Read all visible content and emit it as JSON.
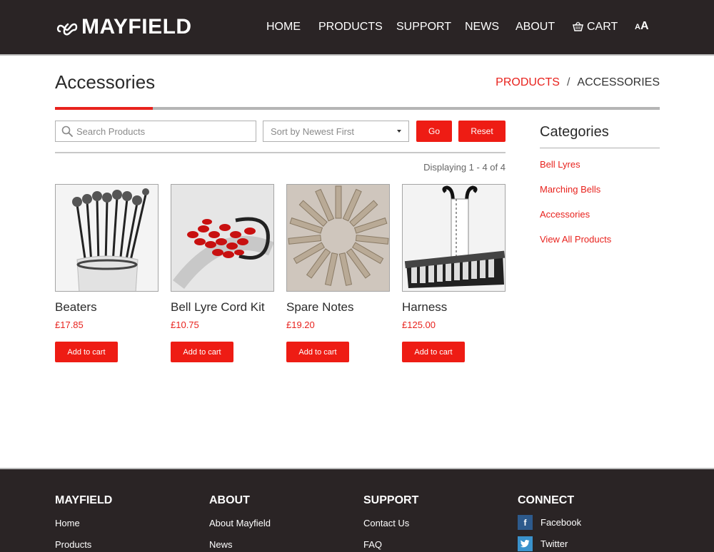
{
  "brand": {
    "name": "MAYFIELD"
  },
  "nav": {
    "items": [
      {
        "label": "HOME"
      },
      {
        "label": "PRODUCTS"
      },
      {
        "label": "SUPPORT"
      },
      {
        "label": "NEWS"
      },
      {
        "label": "ABOUT"
      },
      {
        "label": "CART"
      }
    ],
    "font_small": "A",
    "font_large": "A"
  },
  "page": {
    "title": "Accessories",
    "breadcrumb": {
      "parent": "PRODUCTS",
      "separator": "/",
      "current": "ACCESSORIES"
    }
  },
  "toolbar": {
    "search_placeholder": "Search Products",
    "sort_value": "Sort by Newest First",
    "go_label": "Go",
    "reset_label": "Reset",
    "displaying": "Displaying 1 - 4 of 4"
  },
  "products": [
    {
      "name": "Beaters",
      "price": "£17.85",
      "button": "Add to cart"
    },
    {
      "name": "Bell Lyre Cord Kit",
      "price": "£10.75",
      "button": "Add to cart"
    },
    {
      "name": "Spare Notes",
      "price": "£19.20",
      "button": "Add to cart"
    },
    {
      "name": "Harness",
      "price": "£125.00",
      "button": "Add to cart"
    }
  ],
  "sidebar": {
    "title": "Categories",
    "links": [
      {
        "label": "Bell Lyres"
      },
      {
        "label": "Marching Bells"
      },
      {
        "label": "Accessories"
      },
      {
        "label": "View All Products"
      }
    ]
  },
  "footer": {
    "columns": [
      {
        "heading": "MAYFIELD",
        "links": [
          "Home",
          "Products"
        ]
      },
      {
        "heading": "ABOUT",
        "links": [
          "About Mayfield",
          "News"
        ]
      },
      {
        "heading": "SUPPORT",
        "links": [
          "Contact Us",
          "FAQ"
        ]
      },
      {
        "heading": "CONNECT",
        "links": [
          "Facebook",
          "Twitter"
        ]
      }
    ],
    "social_icons": [
      "facebook-icon",
      "twitter-icon"
    ]
  },
  "colors": {
    "accent": "#e8221d",
    "header_bg": "#2a2425"
  }
}
